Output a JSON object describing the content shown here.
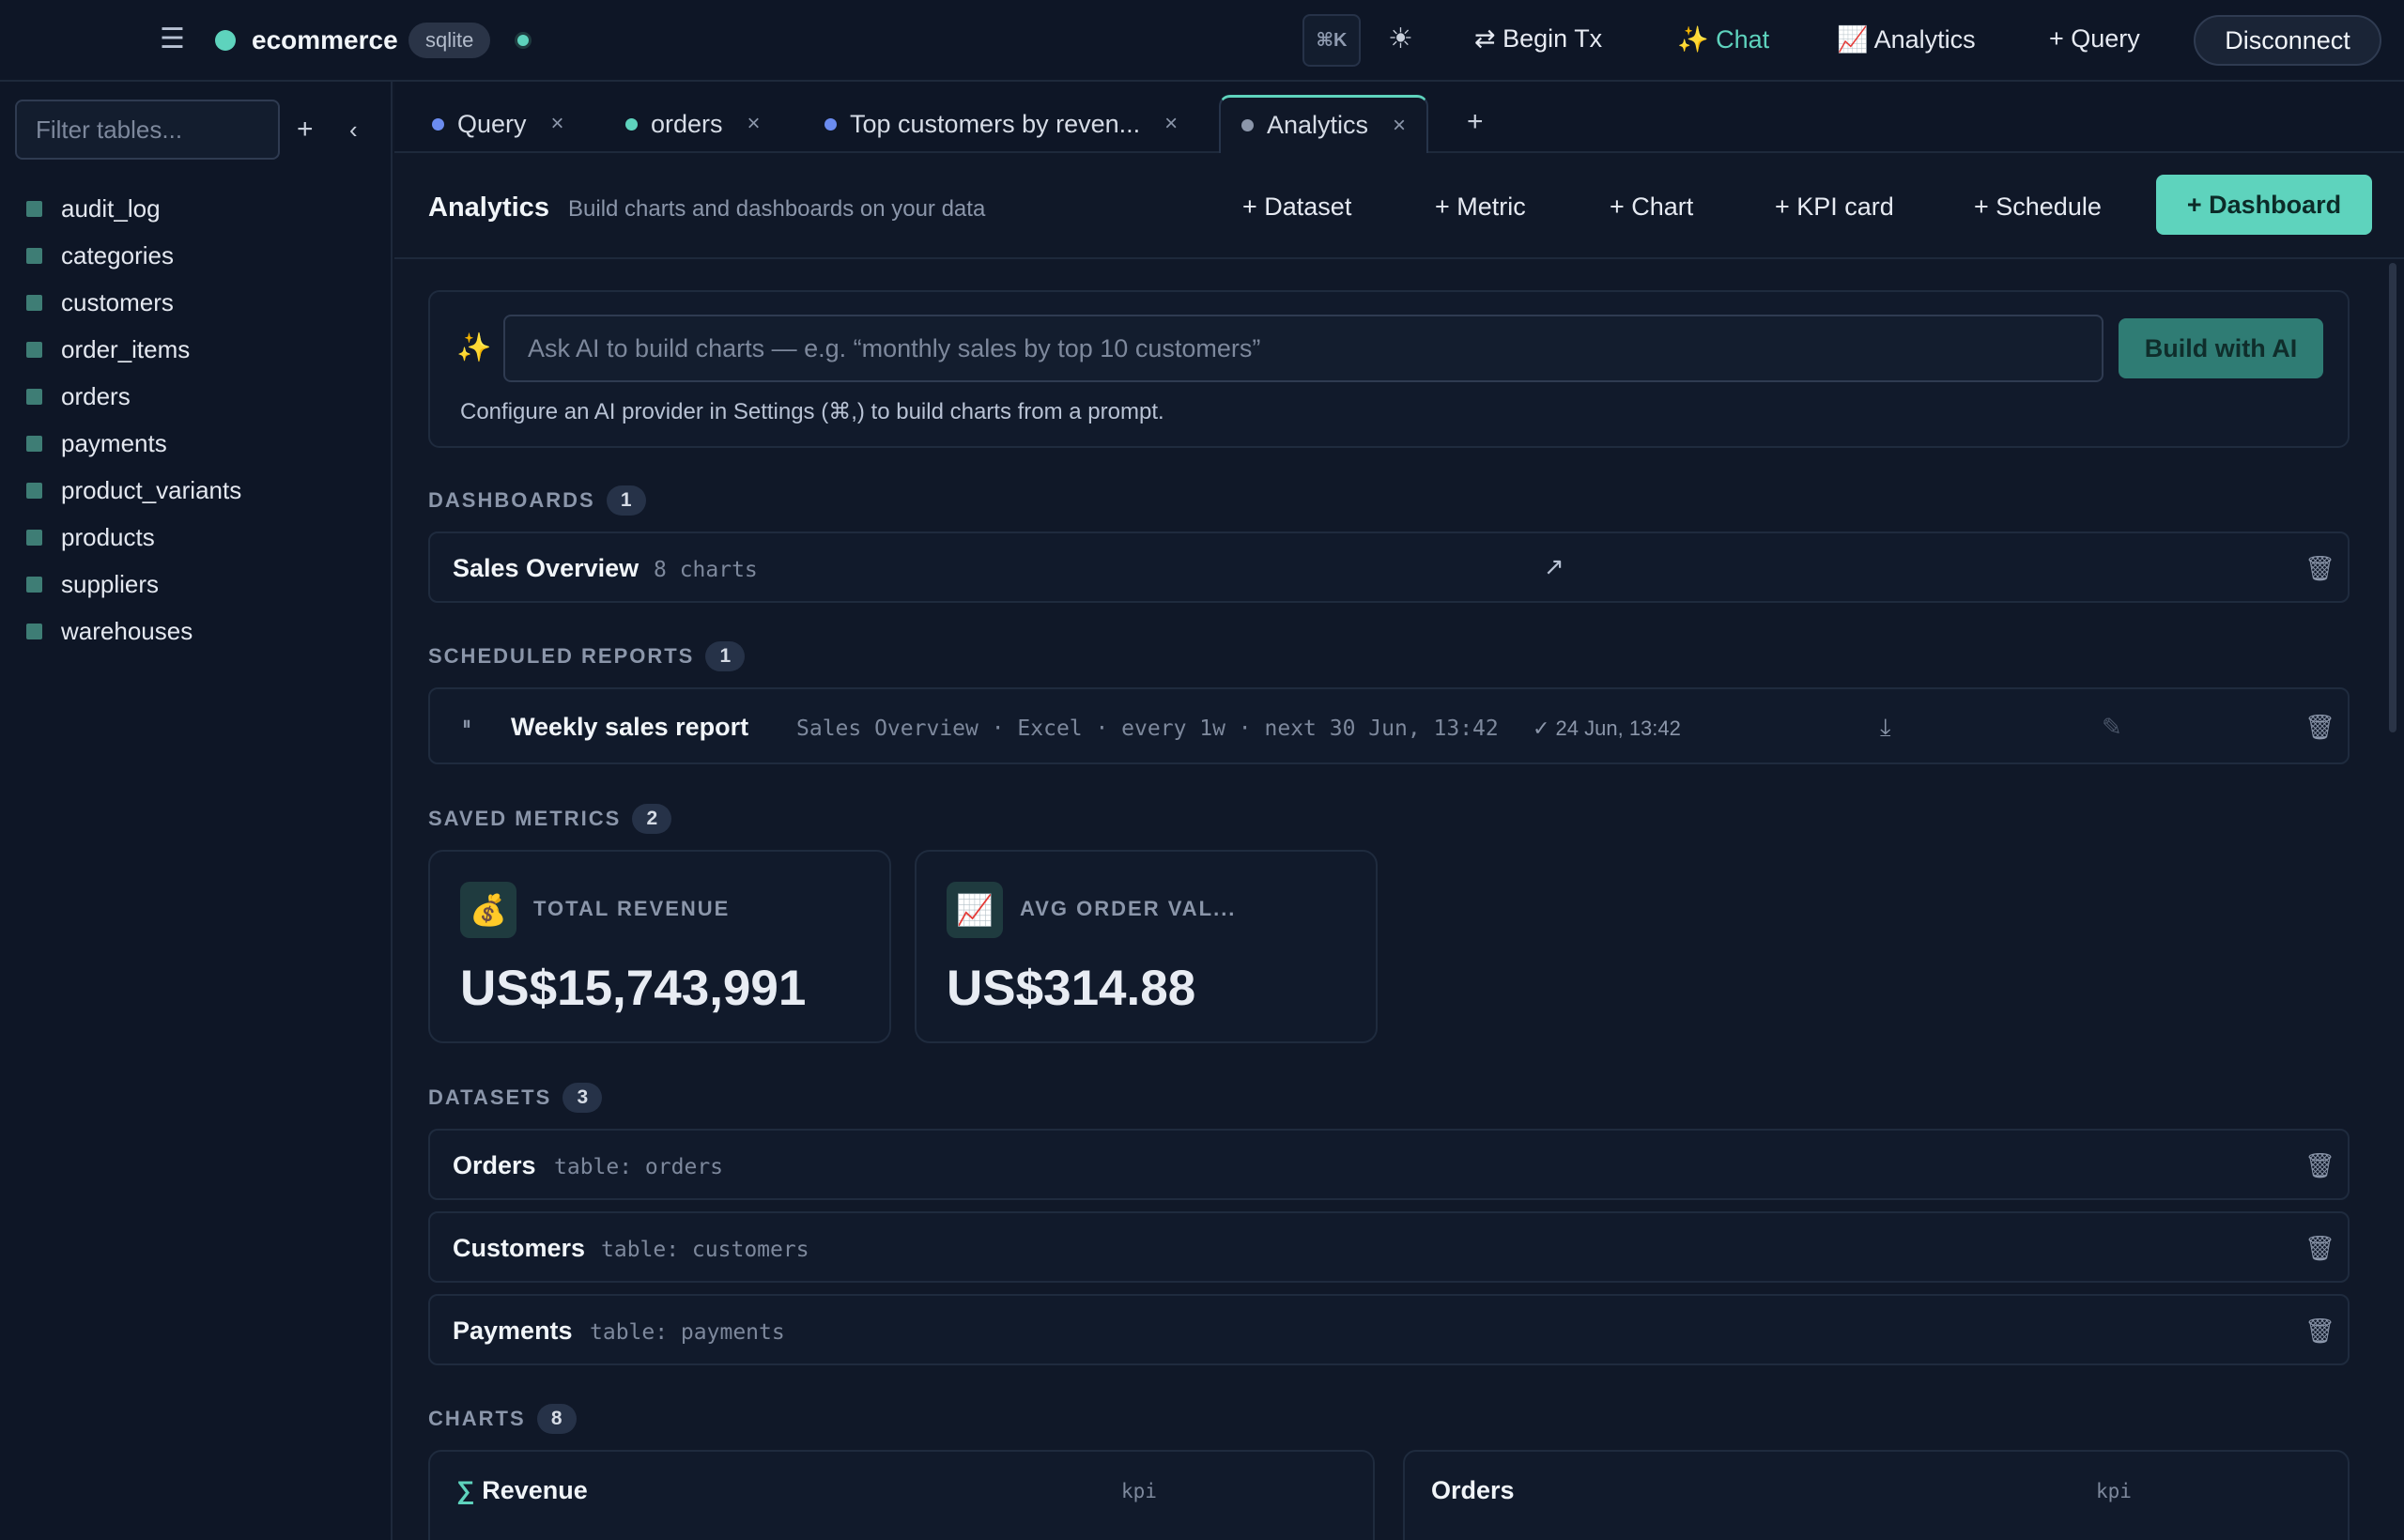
{
  "topbar": {
    "menu_icon": "hamburger-icon",
    "db_name": "ecommerce",
    "db_type": "sqlite",
    "cmdk_label": "⌘K",
    "theme_icon": "sun-icon",
    "begin_tx": "⇄ Begin Tx",
    "chat": "✨ Chat",
    "analytics": "📈 Analytics",
    "query": "+ Query",
    "disconnect": "Disconnect",
    "accent_color": "#5ed3bd"
  },
  "sidebar": {
    "filter_placeholder": "Filter tables...",
    "add_label": "+",
    "collapse_label": "‹",
    "tables": [
      "audit_log",
      "categories",
      "customers",
      "order_items",
      "orders",
      "payments",
      "product_variants",
      "products",
      "suppliers",
      "warehouses"
    ]
  },
  "tabs": [
    {
      "label": "Query",
      "dot_color": "#6b8cf0"
    },
    {
      "label": "orders",
      "dot_color": "#5ed3bd"
    },
    {
      "label": "Top customers by reven...",
      "dot_color": "#6b8cf0"
    },
    {
      "label": "Analytics",
      "dot_color": "#8b96aa",
      "active": true
    }
  ],
  "tab_close_label": "×",
  "new_tab_label": "+",
  "analytics": {
    "title": "Analytics",
    "subtitle": "Build charts and dashboards on your data",
    "buttons": {
      "dataset": "+ Dataset",
      "metric": "+ Metric",
      "chart": "+ Chart",
      "kpi": "+ KPI card",
      "schedule": "+ Schedule",
      "dashboard": "+ Dashboard"
    }
  },
  "ai": {
    "icon": "sparkle-icon",
    "sparkle": "✨",
    "placeholder": "Ask AI to build charts — e.g. “monthly sales by top 10 customers”",
    "button": "Build with AI",
    "hint": "Configure an AI provider in Settings (⌘,) to build charts from a prompt."
  },
  "dashboards": {
    "label": "DASHBOARDS",
    "count": "1",
    "items": [
      {
        "name": "Sales Overview",
        "meta": "8 charts",
        "open_icon": "↗"
      }
    ]
  },
  "scheduled": {
    "label": "SCHEDULED REPORTS",
    "count": "1",
    "items": [
      {
        "pause_icon": "⏸",
        "name": "Weekly sales report",
        "meta": "Sales Overview · Excel · every 1w · next 30 Jun, 13:42",
        "last_run": "✓ 24 Jun, 13:42",
        "download_icon": "⤓",
        "edit_icon": "✎"
      }
    ]
  },
  "metrics": {
    "label": "SAVED METRICS",
    "count": "2",
    "items": [
      {
        "icon": "💰",
        "label": "TOTAL REVENUE",
        "value": "US$15,743,991"
      },
      {
        "icon": "📈",
        "label": "AVG ORDER VAL...",
        "value": "US$314.88"
      }
    ]
  },
  "datasets": {
    "label": "DATASETS",
    "count": "3",
    "items": [
      {
        "name": "Orders",
        "meta": "table: orders"
      },
      {
        "name": "Customers",
        "meta": "table: customers"
      },
      {
        "name": "Payments",
        "meta": "table: payments"
      }
    ]
  },
  "charts": {
    "label": "CHARTS",
    "count": "8",
    "items": [
      {
        "sigma": "∑",
        "name": "Revenue",
        "type": "kpi"
      },
      {
        "sigma": "",
        "name": "Orders",
        "type": "kpi"
      }
    ]
  },
  "trash_icon": "🗑"
}
